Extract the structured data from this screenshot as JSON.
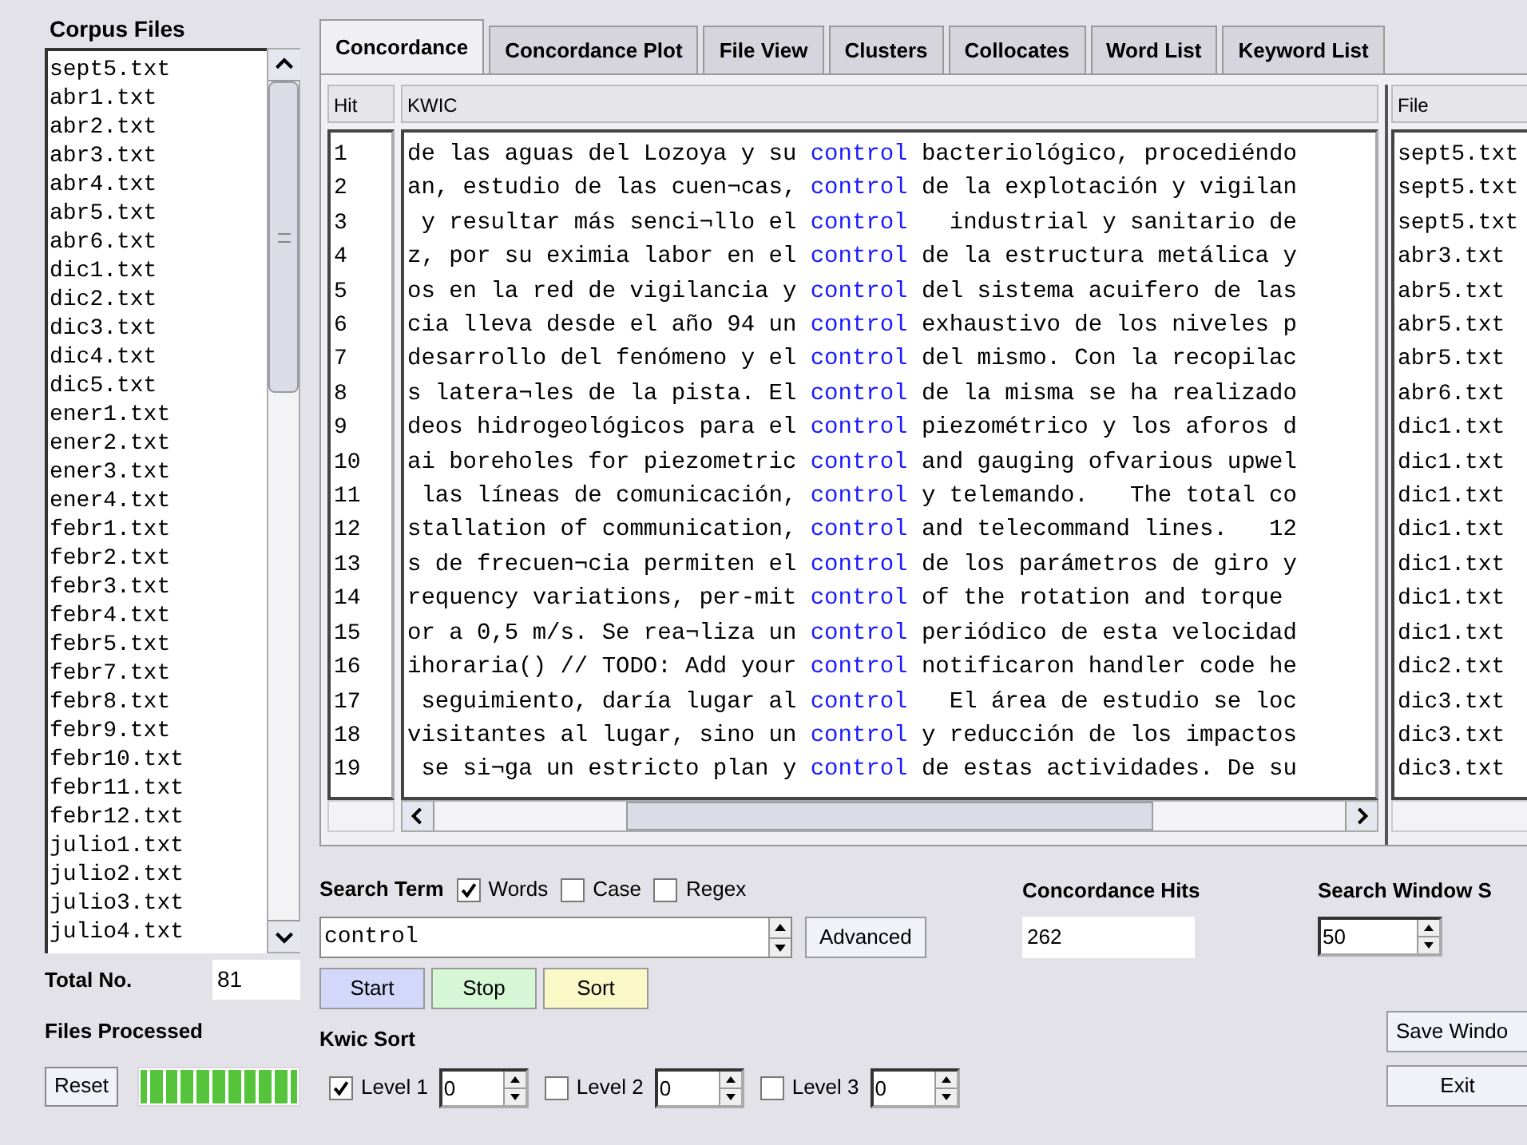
{
  "corpus_files": {
    "title": "Corpus Files",
    "items": [
      "sept5.txt",
      "abr1.txt",
      "abr2.txt",
      "abr3.txt",
      "abr4.txt",
      "abr5.txt",
      "abr6.txt",
      "dic1.txt",
      "dic2.txt",
      "dic3.txt",
      "dic4.txt",
      "dic5.txt",
      "ener1.txt",
      "ener2.txt",
      "ener3.txt",
      "ener4.txt",
      "febr1.txt",
      "febr2.txt",
      "febr3.txt",
      "febr4.txt",
      "febr5.txt",
      "febr7.txt",
      "febr8.txt",
      "febr9.txt",
      "febr10.txt",
      "febr11.txt",
      "febr12.txt",
      "julio1.txt",
      "julio2.txt",
      "julio3.txt",
      "julio4.txt"
    ],
    "total_label": "Total No.",
    "total_value": "81",
    "processed_label": "Files Processed",
    "reset_button": "Reset",
    "progress": {
      "level": 1
    }
  },
  "tabs": [
    {
      "label": "Concordance",
      "selected": true
    },
    {
      "label": "Concordance Plot",
      "selected": false
    },
    {
      "label": "File View",
      "selected": false
    },
    {
      "label": "Clusters",
      "selected": false
    },
    {
      "label": "Collocates",
      "selected": false
    },
    {
      "label": "Word List",
      "selected": false
    },
    {
      "label": "Keyword List",
      "selected": false
    }
  ],
  "table": {
    "columns": [
      "Hit",
      "KWIC",
      "File"
    ],
    "rows": [
      {
        "hit": "1",
        "left": "de las aguas del Lozoya y su ",
        "key": "control",
        "right": " bacteriológico, procediéndo",
        "file": "sept5.txt"
      },
      {
        "hit": "2",
        "left": "an, estudio de las cuen¬cas, ",
        "key": "control",
        "right": " de la explotación y vigilan",
        "file": "sept5.txt"
      },
      {
        "hit": "3",
        "left": " y resultar más senci¬llo el ",
        "key": "control",
        "right": "   industrial y sanitario de",
        "file": "sept5.txt"
      },
      {
        "hit": "4",
        "left": "z, por su eximia labor en el ",
        "key": "control",
        "right": " de la estructura metálica y",
        "file": "abr3.txt"
      },
      {
        "hit": "5",
        "left": "os en la red de vigilancia y ",
        "key": "control",
        "right": " del sistema acuifero de las",
        "file": "abr5.txt"
      },
      {
        "hit": "6",
        "left": "cia lleva desde el año 94 un ",
        "key": "control",
        "right": " exhaustivo de los niveles p",
        "file": "abr5.txt"
      },
      {
        "hit": "7",
        "left": "desarrollo del fenómeno y el ",
        "key": "control",
        "right": " del mismo. Con la recopilac",
        "file": "abr5.txt"
      },
      {
        "hit": "8",
        "left": "s latera¬les de la pista. El ",
        "key": "control",
        "right": " de la misma se ha realizado",
        "file": "abr6.txt"
      },
      {
        "hit": "9",
        "left": "deos hidrogeológicos para el ",
        "key": "control",
        "right": " piezométrico y los aforos d",
        "file": "dic1.txt"
      },
      {
        "hit": "10",
        "left": "ai boreholes for piezometric ",
        "key": "control",
        "right": " and gauging ofvarious upwel",
        "file": "dic1.txt"
      },
      {
        "hit": "11",
        "left": " las líneas de comunicación, ",
        "key": "control",
        "right": " y telemando.   The total co",
        "file": "dic1.txt"
      },
      {
        "hit": "12",
        "left": "stallation of communication, ",
        "key": "control",
        "right": " and telecommand lines.   12",
        "file": "dic1.txt"
      },
      {
        "hit": "13",
        "left": "s de frecuen¬cia permiten el ",
        "key": "control",
        "right": " de los parámetros de giro y",
        "file": "dic1.txt"
      },
      {
        "hit": "14",
        "left": "requency variations, per-mit ",
        "key": "control",
        "right": " of the rotation and torque",
        "file": "dic1.txt"
      },
      {
        "hit": "15",
        "left": "or a 0,5 m/s. Se rea¬liza un ",
        "key": "control",
        "right": " periódico de esta velocidad",
        "file": "dic1.txt"
      },
      {
        "hit": "16",
        "left": "ihoraria() // TODO: Add your ",
        "key": "control",
        "right": " notificaron handler code he",
        "file": "dic2.txt"
      },
      {
        "hit": "17",
        "left": " seguimiento, daría lugar al ",
        "key": "control",
        "right": "   El área de estudio se loc",
        "file": "dic3.txt"
      },
      {
        "hit": "18",
        "left": "visitantes al lugar, sino un ",
        "key": "control",
        "right": " y reducción de los impactos",
        "file": "dic3.txt"
      },
      {
        "hit": "19",
        "left": " se si¬ga un estricto plan y ",
        "key": "control",
        "right": " de estas actividades. De su",
        "file": "dic3.txt"
      }
    ]
  },
  "search": {
    "label": "Search Term",
    "options": [
      {
        "label": "Words",
        "checked": true
      },
      {
        "label": "Case",
        "checked": false
      },
      {
        "label": "Regex",
        "checked": false
      }
    ],
    "value": "control",
    "advanced_button": "Advanced",
    "start_button": "Start",
    "stop_button": "Stop",
    "sort_button": "Sort"
  },
  "hits": {
    "label": "Concordance Hits",
    "value": "262"
  },
  "search_window": {
    "label": "Search Window S",
    "value": "50"
  },
  "kwic_sort": {
    "label": "Kwic Sort",
    "levels": [
      {
        "label": "Level 1",
        "checked": true,
        "value": "0"
      },
      {
        "label": "Level 2",
        "checked": false,
        "value": "0"
      },
      {
        "label": "Level 3",
        "checked": false,
        "value": "0"
      }
    ]
  },
  "save_button": "Save Windo",
  "exit_button": "Exit"
}
